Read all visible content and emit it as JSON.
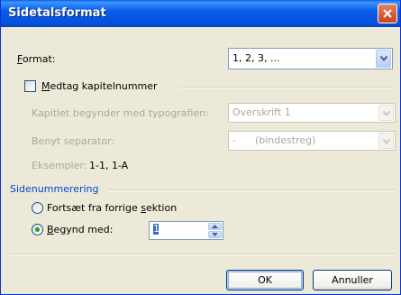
{
  "window": {
    "title": "Sidetalsformat"
  },
  "format": {
    "label_pre": "",
    "label_u": "F",
    "label_post": "ormat:",
    "value": "1, 2, 3, ..."
  },
  "chapter": {
    "checkbox_pre": "",
    "checkbox_u": "M",
    "checkbox_post": "edtag kapitelnummer",
    "style_label": "Kapitlet begynder med typografien:",
    "style_value": "Overskrift 1",
    "separator_label": "Benyt separator:",
    "separator_value": "-      (bindestreg)",
    "examples_label": "Eksempler:",
    "examples_value": "1-1, 1-A"
  },
  "numbering": {
    "group_label": "Sidenummerering",
    "continue_pre": "Fortsæt fra forrige ",
    "continue_u": "s",
    "continue_post": "ektion",
    "start_pre": "",
    "start_u": "B",
    "start_post": "egynd med:",
    "start_value": "1"
  },
  "buttons": {
    "ok": "OK",
    "cancel": "Annuller"
  },
  "colors": {
    "titlebar": "#0A5DE8",
    "group_label": "#0046D5",
    "disabled_text": "#ACA899"
  }
}
